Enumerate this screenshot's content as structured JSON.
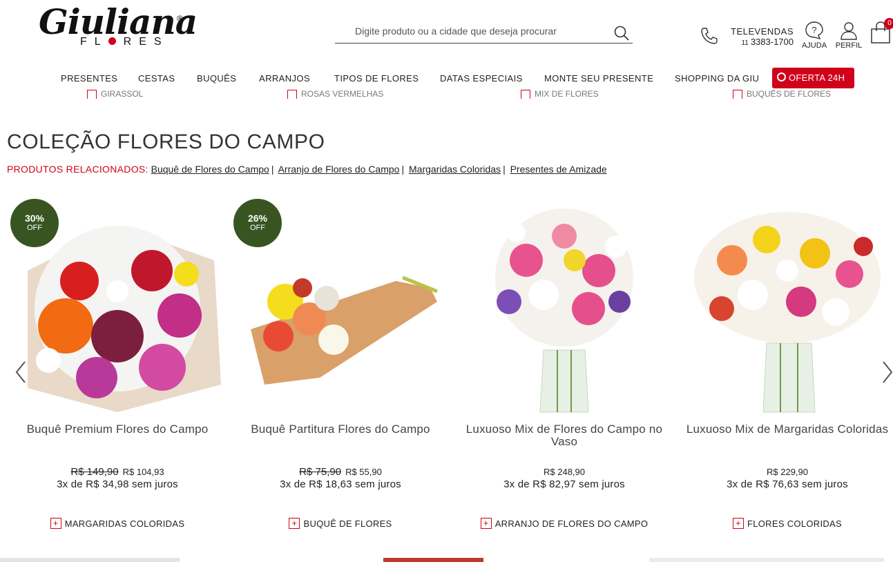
{
  "brand": {
    "logo_script": "Giuliana",
    "logo_reg": "®",
    "logo_sub_1": "FL",
    "logo_sub_2": "RES"
  },
  "search": {
    "placeholder": "Digite produto ou a cidade que deseja procurar"
  },
  "header": {
    "televendas_label": "TELEVENDAS",
    "televendas_area": "11",
    "televendas_number": "3383-1700",
    "help_label": "AJUDA",
    "profile_label": "PERFIL",
    "cart_count": "0"
  },
  "nav": {
    "items": [
      "PRESENTES",
      "CESTAS",
      "BUQUÊS",
      "ARRANJOS",
      "TIPOS DE FLORES",
      "DATAS ESPECIAIS",
      "MONTE SEU PRESENTE",
      "SHOPPING DA GIU"
    ],
    "offer": "OFERTA 24H"
  },
  "ghost_row": [
    "GIRASSOL",
    "ROSAS VERMELHAS",
    "MIX DE FLORES",
    "BUQUÊS DE FLORES"
  ],
  "page": {
    "title": "COLEÇÃO FLORES DO CAMPO",
    "related_label": "PRODUTOS RELACIONADOS:",
    "related_links": [
      "Buquê de Flores do Campo",
      "Arranjo de Flores do Campo",
      "Margaridas Coloridas",
      "Presentes de Amizade"
    ]
  },
  "products": [
    {
      "badge_pct": "30%",
      "badge_off": "OFF",
      "name": "Buquê Premium Flores do Campo",
      "old_price": "R$ 149,90",
      "price": "R$ 104,93",
      "installments": "3x de R$ 34,98 sem juros",
      "category": "MARGARIDAS COLORIDAS"
    },
    {
      "badge_pct": "26%",
      "badge_off": "OFF",
      "name": "Buquê Partitura Flores do Campo",
      "old_price": "R$ 75,90",
      "price": "R$ 55,90",
      "installments": "3x de R$ 18,63 sem juros",
      "category": "BUQUÊ DE FLORES"
    },
    {
      "name": "Luxuoso Mix de Flores do Campo no Vaso",
      "price": "R$ 248,90",
      "installments": "3x de R$ 82,97 sem juros",
      "category": "ARRANJO DE FLORES DO CAMPO"
    },
    {
      "name": "Luxuoso Mix de Margaridas Coloridas",
      "price": "R$ 229,90",
      "installments": "3x de R$ 76,63 sem juros",
      "category": "FLORES COLORIDAS"
    }
  ],
  "colors": {
    "brand_red": "#d0021b",
    "badge_green": "#385521"
  }
}
